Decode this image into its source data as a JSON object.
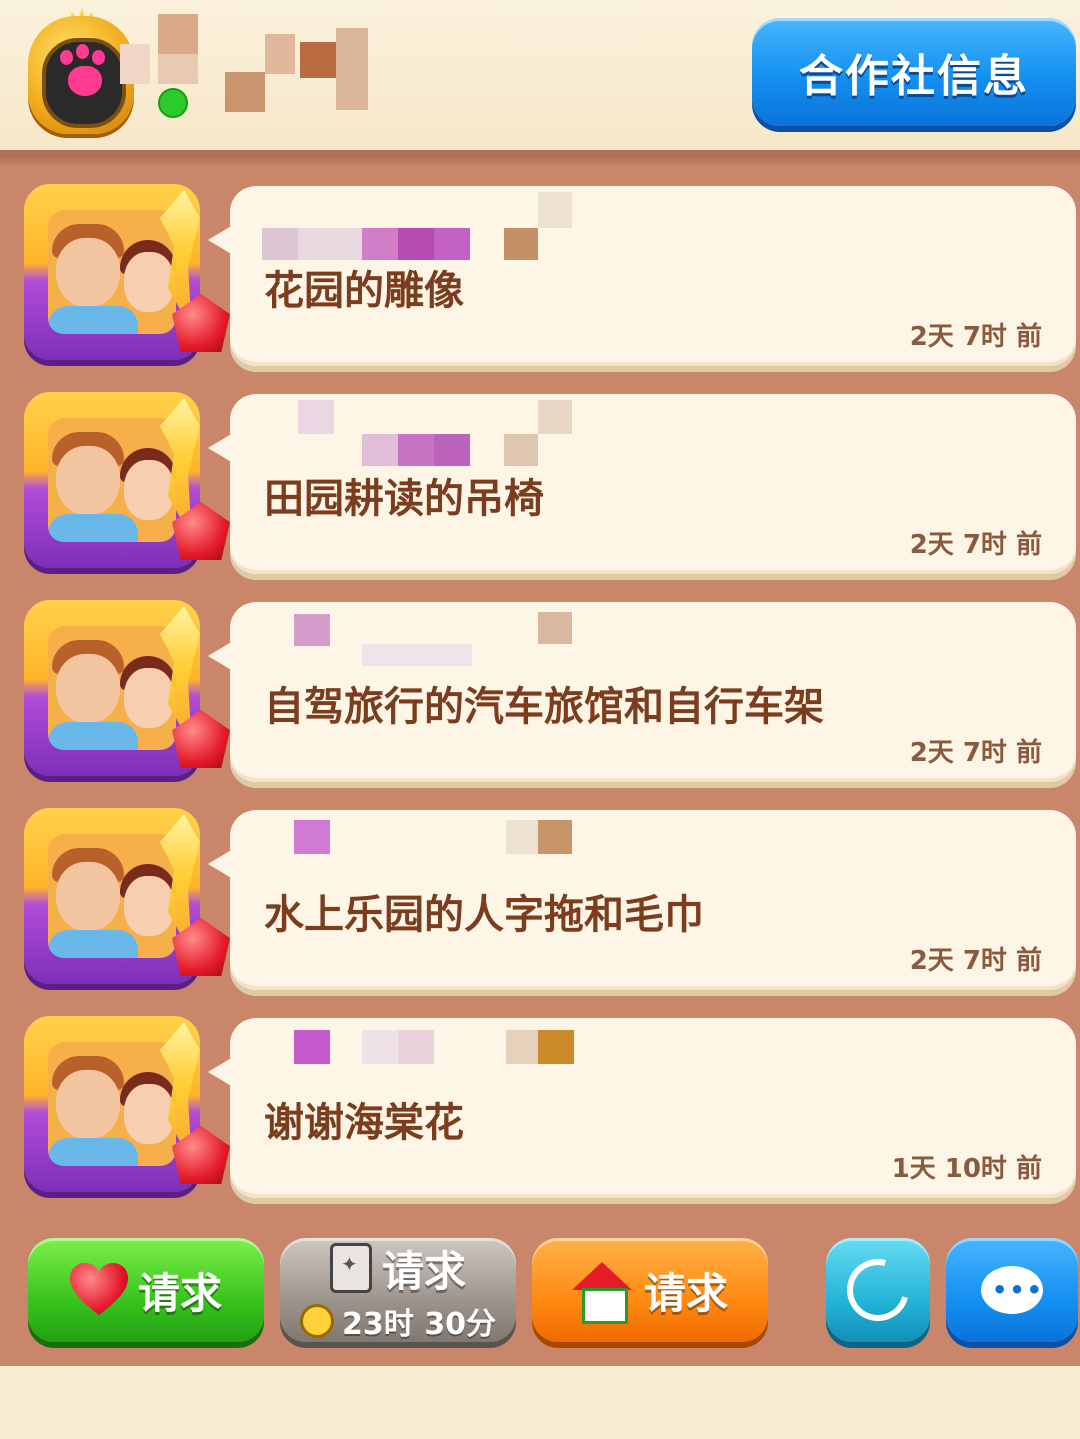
{
  "header": {
    "info_button_label": "合作社信息"
  },
  "messages": [
    {
      "text": "花园的雕像",
      "time": "2天 7时 前"
    },
    {
      "text": "田园耕读的吊椅",
      "time": "2天 7时 前"
    },
    {
      "text": "自驾旅行的汽车旅馆和自行车架",
      "time": "2天 7时 前"
    },
    {
      "text": "水上乐园的人字拖和毛巾",
      "time": "2天 7时 前"
    },
    {
      "text": "谢谢海棠花",
      "time": "1天 10时 前"
    }
  ],
  "actions": {
    "lives_request_label": "请求",
    "cards_request_label": "请求",
    "cards_timer": "23时 30分",
    "house_request_label": "请求"
  },
  "colors": {
    "panel": "#c9866a",
    "bubble": "#fdf6e7",
    "message_text": "#7b3d1e",
    "info_button": "#1390f0"
  },
  "icons": [
    "paw-icon",
    "heart-icon",
    "cards-icon",
    "clock-icon",
    "house-icon",
    "leaf-icon",
    "chat-icon"
  ]
}
